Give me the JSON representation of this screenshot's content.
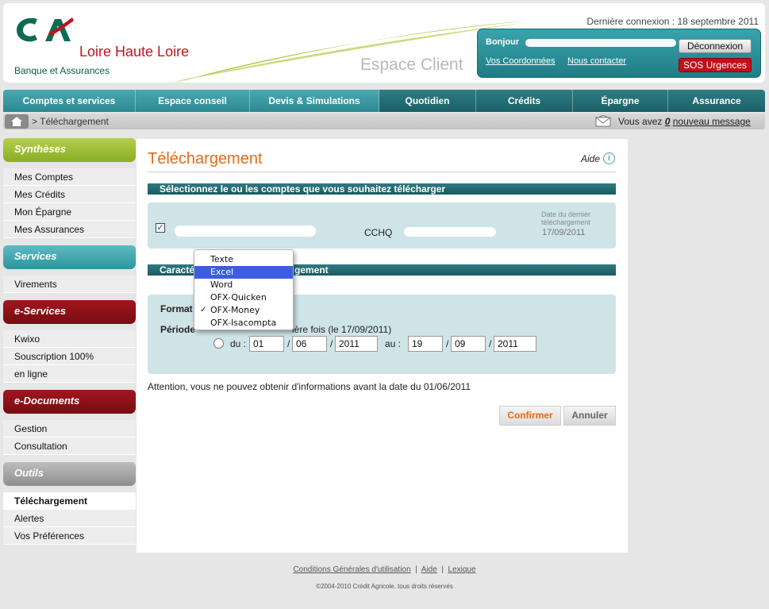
{
  "header": {
    "brand_name": "Loire Haute Loire",
    "brand_sub": "Banque et Assurances",
    "espace_client": "Espace Client",
    "last_login": "Dernière connexion : 18 septembre 2011",
    "greeting": "Bonjour",
    "link_coordonnees": "Vos Coordonnées",
    "link_contact": "Nous contacter",
    "logout_label": "Déconnexion",
    "sos_label": "SOS Urgences",
    "colors": {
      "brand_red": "#c0141e",
      "teal": "#2e949d"
    }
  },
  "topnav": {
    "tabs": [
      {
        "label": "Comptes et services"
      },
      {
        "label": "Espace conseil"
      },
      {
        "label": "Devis & Simulations"
      },
      {
        "label": "Quotidien"
      },
      {
        "label": "Crédits"
      },
      {
        "label": "Épargne"
      },
      {
        "label": "Assurance"
      }
    ]
  },
  "breadcrumb": {
    "home_icon": "home-icon",
    "path": "> Téléchargement",
    "msg_prefix": "Vous avez",
    "msg_count": "0",
    "msg_suffix": "nouveau message"
  },
  "sidebar": {
    "syntheses": {
      "title": "Synthèses",
      "items": [
        "Mes Comptes",
        "Mes Crédits",
        "Mon Épargne",
        "Mes Assurances"
      ]
    },
    "services": {
      "title": "Services",
      "items": [
        "Virements"
      ]
    },
    "eservices": {
      "title": "e-Services",
      "items": [
        "Kwixo",
        "Souscription 100%",
        "en ligne"
      ]
    },
    "edocuments": {
      "title": "e-Documents",
      "items": [
        "Gestion",
        "Consultation"
      ]
    },
    "outils": {
      "title": "Outils",
      "items": [
        "Téléchargement",
        "Alertes",
        "Vos Préférences"
      ]
    }
  },
  "main": {
    "title": "Téléchargement",
    "help_label": "Aide",
    "help_icon": "i",
    "section_accounts": "Sélectionnez le ou les comptes que vous souhaitez télécharger",
    "account_type": "CCHQ",
    "last_download_label": "Date du dernier téléchargement",
    "last_download_date": "17/09/2011",
    "section_characteristics_left": "Caracté",
    "section_characteristics_right": "gement",
    "format_label": "Format",
    "period_label": "Période",
    "period_option1_visible": "ière fois (le 17/09/2011)",
    "period_du": "du :",
    "period_au": "au :",
    "date_from": {
      "day": "01",
      "month": "06",
      "year": "2011"
    },
    "date_to": {
      "day": "19",
      "month": "09",
      "year": "2011"
    },
    "slash": "/",
    "warning": "Attention, vous ne pouvez obtenir d'informations avant la date du 01/06/2011",
    "confirm_label": "Confirmer",
    "cancel_label": "Annuler"
  },
  "format_dropdown": {
    "options": [
      "Texte",
      "Excel",
      "Word",
      "OFX-Quicken",
      "OFX-Money",
      "OFX-Isacompta"
    ],
    "highlighted": "Excel",
    "checked": "OFX-Money",
    "check_mark": "✓"
  },
  "footer": {
    "link_conditions": "Conditions Générales d'utilisation",
    "link_aide": "Aide",
    "link_lexique": "Lexique",
    "separator": "|",
    "copyright": "©2004-2010 Crédit Agricole, tous droits réservés"
  }
}
